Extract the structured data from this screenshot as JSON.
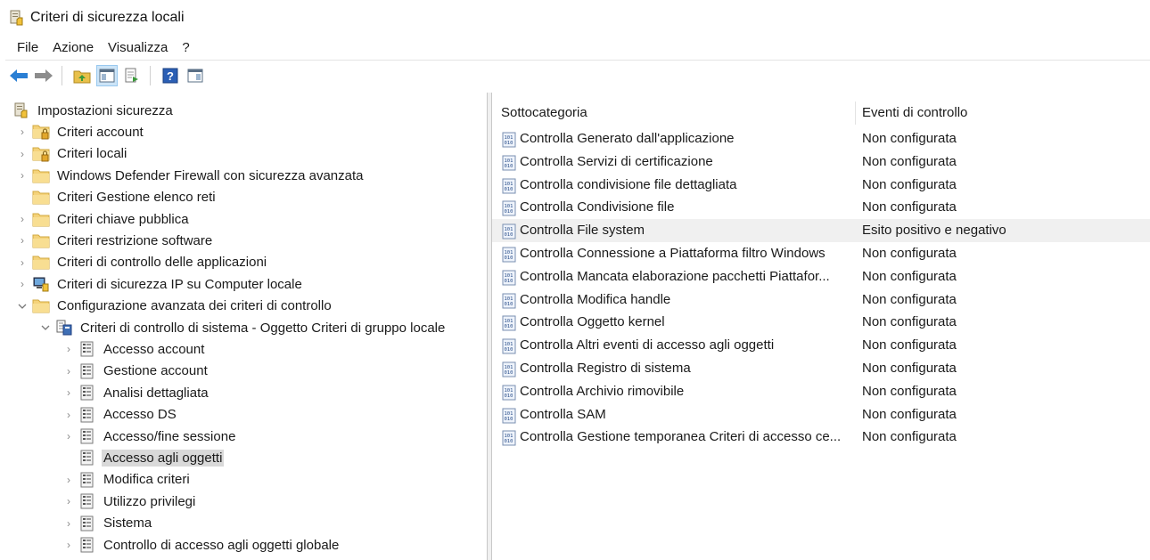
{
  "window": {
    "title": "Criteri di sicurezza locali"
  },
  "menu": [
    "File",
    "Azione",
    "Visualizza",
    "?"
  ],
  "toolbar": {
    "buttons": [
      "back-arrow-icon",
      "forward-arrow-icon",
      "up-folder-icon",
      "show-hide-console-tree-icon",
      "export-list-icon",
      "help-icon",
      "properties-icon"
    ]
  },
  "tree": {
    "items": [
      {
        "label": "Impostazioni sicurezza",
        "level": 0,
        "expander": "none",
        "icon": "security-settings-icon"
      },
      {
        "label": "Criteri account",
        "level": 1,
        "expander": "collapsed",
        "icon": "locked-folder-icon"
      },
      {
        "label": "Criteri locali",
        "level": 1,
        "expander": "collapsed",
        "icon": "locked-folder-icon"
      },
      {
        "label": "Windows Defender Firewall con sicurezza avanzata",
        "level": 1,
        "expander": "collapsed",
        "icon": "folder-icon"
      },
      {
        "label": "Criteri Gestione elenco reti",
        "level": 1,
        "expander": "none",
        "icon": "folder-icon"
      },
      {
        "label": "Criteri chiave pubblica",
        "level": 1,
        "expander": "collapsed",
        "icon": "folder-icon"
      },
      {
        "label": "Criteri restrizione software",
        "level": 1,
        "expander": "collapsed",
        "icon": "folder-icon"
      },
      {
        "label": "Criteri di controllo delle applicazioni",
        "level": 1,
        "expander": "collapsed",
        "icon": "folder-icon"
      },
      {
        "label": "Criteri di sicurezza IP su Computer locale",
        "level": 1,
        "expander": "collapsed",
        "icon": "ip-security-icon"
      },
      {
        "label": "Configurazione avanzata dei criteri di controllo",
        "level": 1,
        "expander": "expanded",
        "icon": "folder-icon"
      },
      {
        "label": "Criteri di controllo di sistema - Oggetto Criteri di gruppo locale",
        "level": 2,
        "expander": "expanded",
        "icon": "audit-policy-icon"
      },
      {
        "label": "Accesso account",
        "level": 3,
        "expander": "collapsed",
        "icon": "policy-list-icon"
      },
      {
        "label": "Gestione account",
        "level": 3,
        "expander": "collapsed",
        "icon": "policy-list-icon"
      },
      {
        "label": "Analisi dettagliata",
        "level": 3,
        "expander": "collapsed",
        "icon": "policy-list-icon"
      },
      {
        "label": "Accesso DS",
        "level": 3,
        "expander": "collapsed",
        "icon": "policy-list-icon"
      },
      {
        "label": "Accesso/fine sessione",
        "level": 3,
        "expander": "collapsed",
        "icon": "policy-list-icon"
      },
      {
        "label": "Accesso agli oggetti",
        "level": 3,
        "expander": "none",
        "icon": "policy-list-icon",
        "selected": true
      },
      {
        "label": "Modifica criteri",
        "level": 3,
        "expander": "collapsed",
        "icon": "policy-list-icon"
      },
      {
        "label": "Utilizzo privilegi",
        "level": 3,
        "expander": "collapsed",
        "icon": "policy-list-icon"
      },
      {
        "label": "Sistema",
        "level": 3,
        "expander": "collapsed",
        "icon": "policy-list-icon"
      },
      {
        "label": "Controllo di accesso agli oggetti globale",
        "level": 3,
        "expander": "collapsed",
        "icon": "policy-list-icon"
      }
    ]
  },
  "list": {
    "columns": [
      "Sottocategoria",
      "Eventi di controllo"
    ],
    "rows": [
      {
        "name": "Controlla Generato dall'applicazione",
        "value": "Non configurata"
      },
      {
        "name": "Controlla Servizi di certificazione",
        "value": "Non configurata"
      },
      {
        "name": "Controlla condivisione file dettagliata",
        "value": "Non configurata"
      },
      {
        "name": "Controlla Condivisione file",
        "value": "Non configurata"
      },
      {
        "name": "Controlla File system",
        "value": "Esito positivo e negativo",
        "selected": true
      },
      {
        "name": "Controlla Connessione a Piattaforma filtro Windows",
        "value": "Non configurata"
      },
      {
        "name": "Controlla Mancata elaborazione pacchetti Piattafor...",
        "value": "Non configurata"
      },
      {
        "name": "Controlla Modifica handle",
        "value": "Non configurata"
      },
      {
        "name": "Controlla Oggetto kernel",
        "value": "Non configurata"
      },
      {
        "name": "Controlla Altri eventi di accesso agli oggetti",
        "value": "Non configurata"
      },
      {
        "name": "Controlla Registro di sistema",
        "value": "Non configurata"
      },
      {
        "name": "Controlla Archivio rimovibile",
        "value": "Non configurata"
      },
      {
        "name": "Controlla SAM",
        "value": "Non configurata"
      },
      {
        "name": "Controlla Gestione temporanea Criteri di accesso ce...",
        "value": "Non configurata"
      }
    ]
  }
}
